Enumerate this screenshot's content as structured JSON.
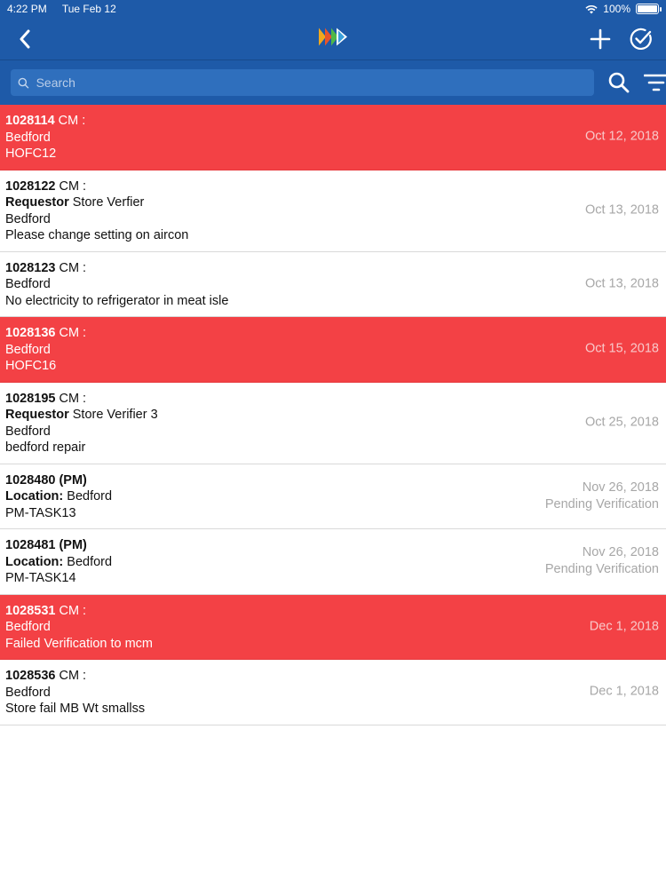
{
  "status": {
    "time": "4:22 PM",
    "date": "Tue Feb 12",
    "battery": "100%"
  },
  "search": {
    "placeholder": "Search"
  },
  "colors": {
    "header": "#1e5aa8",
    "alert_row": "#f34145",
    "date_text": "#a7a7a7"
  },
  "icons": {
    "back": "chevron-left-icon",
    "logo": "app-logo-icon",
    "add": "plus-icon",
    "verify": "check-circle-icon",
    "search": "search-icon",
    "filter": "filter-icon"
  },
  "items": [
    {
      "id": "1028114",
      "suffix": " CM :",
      "line1": "Bedford",
      "line2": "HOFC12",
      "date": "Oct 12, 2018"
    },
    {
      "id": "1028122",
      "suffix": " CM :",
      "label": "Requestor",
      "label_value": " Store Verfier",
      "line1": "Bedford",
      "line2": "Please change setting on aircon",
      "date": "Oct 13, 2018"
    },
    {
      "id": "1028123",
      "suffix": " CM :",
      "line1": "Bedford",
      "line2": "No electricity to refrigerator in meat isle",
      "date": "Oct 13, 2018"
    },
    {
      "id": "1028136",
      "suffix": " CM :",
      "line1": "Bedford",
      "line2": "HOFC16",
      "date": "Oct 15, 2018"
    },
    {
      "id": "1028195",
      "suffix": " CM :",
      "label": "Requestor",
      "label_value": " Store Verifier 3",
      "line1": "Bedford",
      "line2": "bedford repair",
      "date": "Oct 25, 2018"
    },
    {
      "id": "1028480 (PM)",
      "label": "Location:",
      "label_value": " Bedford",
      "line1": "PM-TASK13",
      "date": "Nov 26, 2018",
      "status": "Pending Verification"
    },
    {
      "id": "1028481 (PM)",
      "label": "Location:",
      "label_value": " Bedford",
      "line1": "PM-TASK14",
      "date": "Nov 26, 2018",
      "status": "Pending Verification"
    },
    {
      "id": "1028531",
      "suffix": " CM :",
      "line1": "Bedford",
      "line2": "Failed Verification to mcm",
      "date": "Dec 1, 2018"
    },
    {
      "id": "1028536",
      "suffix": " CM :",
      "line1": "Bedford",
      "line2": "Store fail MB Wt smallss",
      "date": "Dec 1, 2018"
    }
  ]
}
